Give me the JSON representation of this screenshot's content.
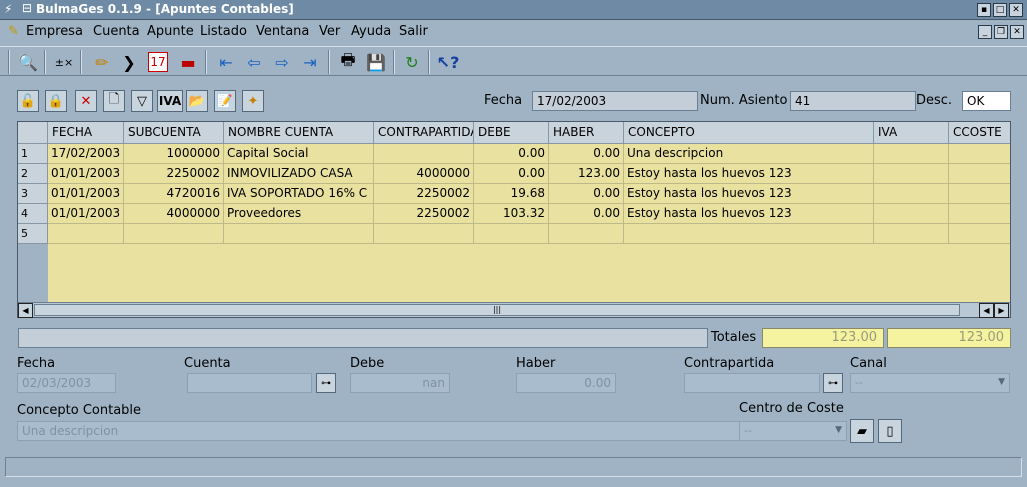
{
  "window": {
    "title": "BulmaGes 0.1.9 - [Apuntes Contables]"
  },
  "menu": {
    "items": [
      {
        "label": "Empresa"
      },
      {
        "label": "Cuenta"
      },
      {
        "label": "Apunte"
      },
      {
        "label": "Listado"
      },
      {
        "label": "Ventana"
      },
      {
        "label": "Ver"
      },
      {
        "label": "Ayuda"
      },
      {
        "label": "Salir"
      }
    ]
  },
  "toolbar": {
    "calendar_day": "17",
    "iva_label": "IVA"
  },
  "header_fields": {
    "fecha_label": "Fecha",
    "fecha_value": "17/02/2003",
    "num_asiento_label": "Num. Asiento",
    "num_asiento_value": "41",
    "desc_label": "Desc.",
    "desc_value": "OK"
  },
  "table": {
    "columns": [
      "FECHA",
      "SUBCUENTA",
      "NOMBRE CUENTA",
      "CONTRAPARTIDA",
      "DEBE",
      "HABER",
      "CONCEPTO",
      "IVA",
      "CCOSTE"
    ],
    "rows": [
      {
        "num": "1",
        "fecha": "17/02/2003",
        "subcuenta": "1000000",
        "nombre": "Capital Social",
        "contrapartida": "",
        "debe": "0.00",
        "haber": "0.00",
        "concepto": "Una descripcion",
        "iva": "",
        "ccoste": ""
      },
      {
        "num": "2",
        "fecha": "01/01/2003",
        "subcuenta": "2250002",
        "nombre": "INMOVILIZADO CASA",
        "contrapartida": "4000000",
        "debe": "0.00",
        "haber": "123.00",
        "concepto": "Estoy hasta los huevos 123",
        "iva": "",
        "ccoste": ""
      },
      {
        "num": "3",
        "fecha": "01/01/2003",
        "subcuenta": "4720016",
        "nombre": "IVA SOPORTADO 16% C",
        "contrapartida": "2250002",
        "debe": "19.68",
        "haber": "0.00",
        "concepto": "Estoy hasta los huevos 123",
        "iva": "",
        "ccoste": ""
      },
      {
        "num": "4",
        "fecha": "01/01/2003",
        "subcuenta": "4000000",
        "nombre": "Proveedores",
        "contrapartida": "2250002",
        "debe": "103.32",
        "haber": "0.00",
        "concepto": "Estoy hasta los huevos 123",
        "iva": "",
        "ccoste": ""
      },
      {
        "num": "5",
        "fecha": "",
        "subcuenta": "",
        "nombre": "",
        "contrapartida": "",
        "debe": "",
        "haber": "",
        "concepto": "",
        "iva": "",
        "ccoste": ""
      }
    ]
  },
  "totals": {
    "label": "Totales",
    "debe": "123.00",
    "haber": "123.00"
  },
  "entry": {
    "fecha_label": "Fecha",
    "fecha_value": "02/03/2003",
    "cuenta_label": "Cuenta",
    "cuenta_value": "",
    "debe_label": "Debe",
    "debe_value": "nan",
    "haber_label": "Haber",
    "haber_value": "0.00",
    "contrapartida_label": "Contrapartida",
    "contrapartida_value": "",
    "canal_label": "Canal",
    "canal_value": "--",
    "concepto_label": "Concepto Contable",
    "concepto_value": "Una descripcion",
    "centro_label": "Centro de Coste",
    "centro_value": "--"
  },
  "colors": {
    "window_bg": "#9fb3c4",
    "grid_bg": "#e8e19f",
    "totals_bg": "#f5f3a0"
  }
}
